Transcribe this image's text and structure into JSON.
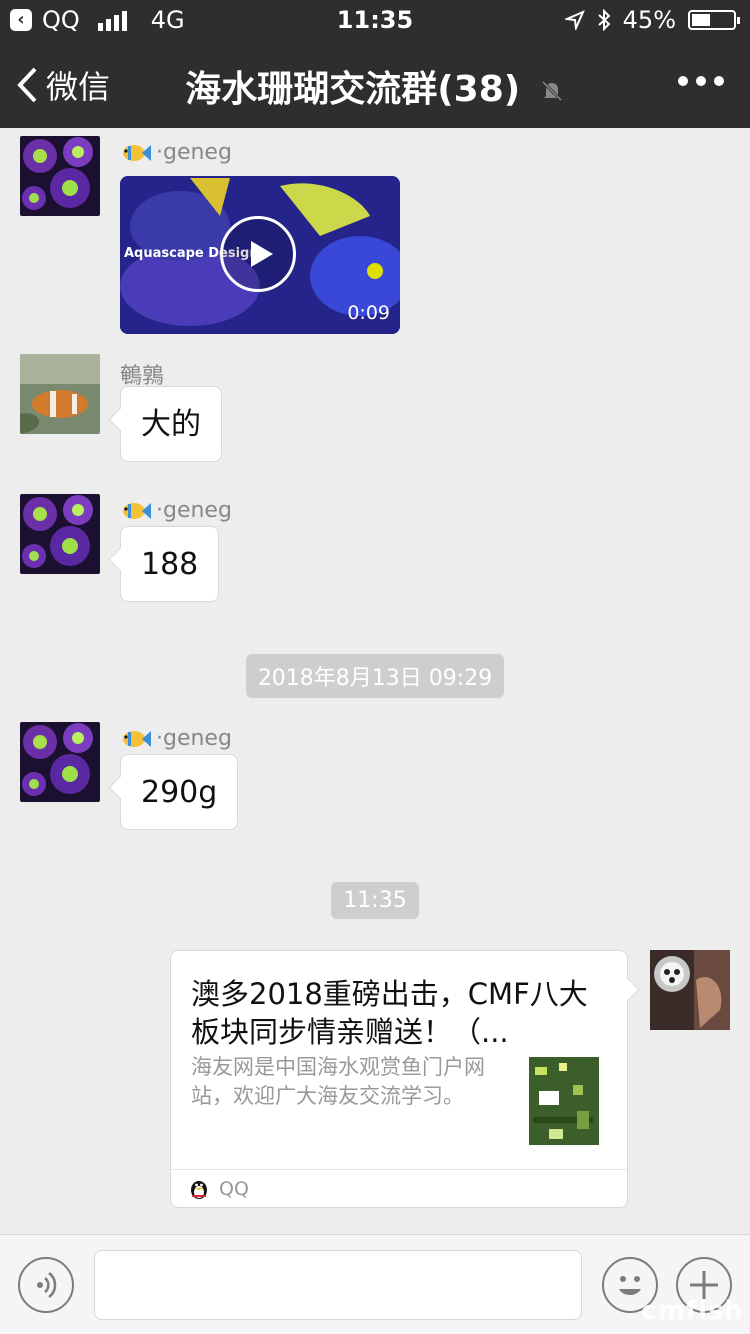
{
  "status_bar": {
    "carrier": "QQ",
    "network": "4G",
    "time": "11:35",
    "battery": "45%",
    "battery_level": 0.45
  },
  "nav": {
    "back_label": "微信",
    "title": "海水珊瑚交流群(38)"
  },
  "messages": [
    {
      "sender": "·geneg",
      "type": "video",
      "video_caption": "Aquascape Design",
      "duration": "0:09"
    },
    {
      "sender": "鵪鶉",
      "type": "text",
      "text": "大的"
    },
    {
      "sender": "·geneg",
      "type": "text",
      "text": "188"
    },
    {
      "type": "timestamp",
      "text": "2018年8月13日 09:29"
    },
    {
      "sender": "·geneg",
      "type": "text",
      "text": "290g"
    },
    {
      "type": "timestamp",
      "text": "11:35"
    }
  ],
  "shared_link": {
    "title": "澳多2018重磅出击，CMF八大板块同步情亲赠送！（...",
    "description": "海友网是中国海水观赏鱼门户网站，欢迎广大海友交流学习。",
    "source": "QQ"
  },
  "input_bar": {
    "voice_icon": "voice-icon",
    "emoji_icon": "emoji-icon",
    "plus_icon": "plus-icon"
  },
  "watermark": "cmfish",
  "colors": {
    "nav_background": "#2e2e2e",
    "chat_background": "#ededed",
    "bubble": "#ffffff"
  }
}
